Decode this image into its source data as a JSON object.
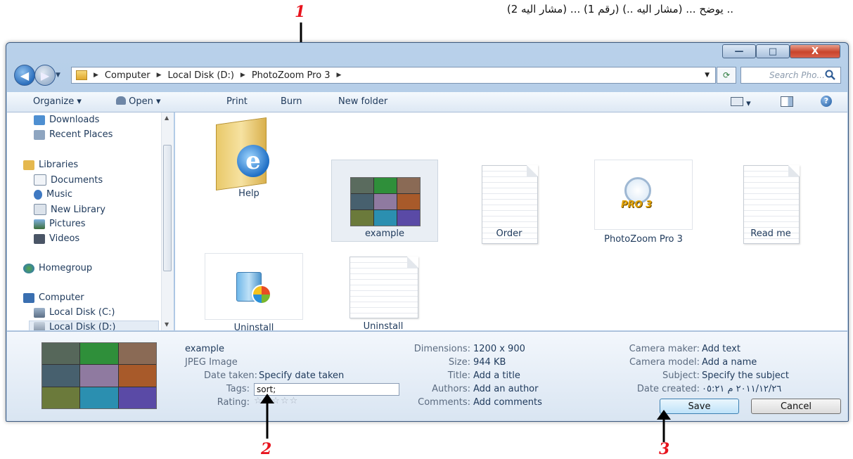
{
  "caption": "يوضح ... (مشار اليه ..) (رقم 1) ... (مشار اليه 2) ..",
  "annotations": [
    "1",
    "2",
    "3"
  ],
  "window_buttons": {
    "minimize": "—",
    "maximize": "□",
    "close": "X"
  },
  "address": {
    "crumbs": [
      "Computer",
      "Local Disk (D:)",
      "PhotoZoom Pro 3"
    ],
    "search_placeholder": "Search Pho...",
    "colors": {
      "accent": "#1e395b",
      "titlebar": "#b9d1ea"
    }
  },
  "toolbar": {
    "organize": "Organize",
    "open": "Open",
    "print": "Print",
    "burn": "Burn",
    "new_folder": "New folder"
  },
  "nav": {
    "items": [
      {
        "label": "Downloads",
        "icon": "downloads-icon"
      },
      {
        "label": "Recent Places",
        "icon": "recent-places-icon"
      },
      {
        "label": "Libraries",
        "icon": "libraries-icon"
      },
      {
        "label": "Documents",
        "icon": "documents-icon"
      },
      {
        "label": "Music",
        "icon": "music-icon"
      },
      {
        "label": "New Library",
        "icon": "library-icon"
      },
      {
        "label": "Pictures",
        "icon": "pictures-icon"
      },
      {
        "label": "Videos",
        "icon": "videos-icon"
      },
      {
        "label": "Homegroup",
        "icon": "homegroup-icon"
      },
      {
        "label": "Computer",
        "icon": "computer-icon"
      },
      {
        "label": "Local Disk (C:)",
        "icon": "drive-icon"
      },
      {
        "label": "Local Disk (D:)",
        "icon": "drive-icon"
      }
    ]
  },
  "files": [
    {
      "label": "Help",
      "icon": "ie-folder-icon"
    },
    {
      "label": "example",
      "icon": "image-mosaic-icon",
      "selected": true
    },
    {
      "label": "Order",
      "icon": "document-icon"
    },
    {
      "label": "PhotoZoom Pro 3",
      "icon": "photozoom-icon"
    },
    {
      "label": "Read me",
      "icon": "document-icon"
    },
    {
      "label": "Uninstall",
      "icon": "installer-icon"
    },
    {
      "label": "Uninstall",
      "icon": "document-icon"
    }
  ],
  "photozoom_logo": "PRO 3",
  "details": {
    "filename": "example",
    "filetype": "JPEG Image",
    "date_taken_label": "Date taken:",
    "date_taken_value": "Specify date taken",
    "tags_label": "Tags:",
    "tags_value": "sort;",
    "rating_label": "Rating:",
    "rating_stars": "☆☆☆☆☆",
    "dimensions_label": "Dimensions:",
    "dimensions_value": "1200 x 900",
    "size_label": "Size:",
    "size_value": "944 KB",
    "title_label": "Title:",
    "title_value": "Add a title",
    "authors_label": "Authors:",
    "authors_value": "Add an author",
    "comments_label": "Comments:",
    "comments_value": "Add comments",
    "camera_maker_label": "Camera maker:",
    "camera_maker_value": "Add text",
    "camera_model_label": "Camera model:",
    "camera_model_value": "Add a name",
    "subject_label": "Subject:",
    "subject_value": "Specify the subject",
    "date_created_label": "Date created:",
    "date_created_value": "٢٠١١/١٢/٢٦ م ٠٥:٢١"
  },
  "buttons": {
    "save": "Save",
    "cancel": "Cancel"
  }
}
